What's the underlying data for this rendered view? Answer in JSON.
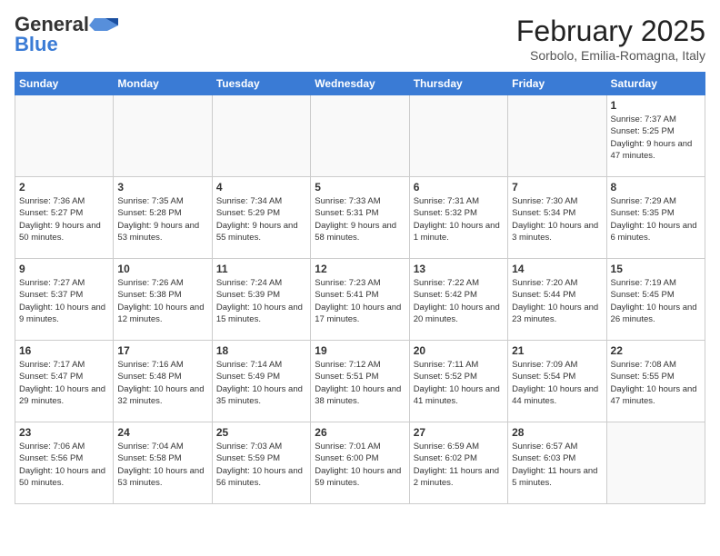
{
  "header": {
    "logo_general": "General",
    "logo_blue": "Blue",
    "month_title": "February 2025",
    "location": "Sorbolo, Emilia-Romagna, Italy"
  },
  "weekdays": [
    "Sunday",
    "Monday",
    "Tuesday",
    "Wednesday",
    "Thursday",
    "Friday",
    "Saturday"
  ],
  "weeks": [
    [
      {
        "day": "",
        "info": ""
      },
      {
        "day": "",
        "info": ""
      },
      {
        "day": "",
        "info": ""
      },
      {
        "day": "",
        "info": ""
      },
      {
        "day": "",
        "info": ""
      },
      {
        "day": "",
        "info": ""
      },
      {
        "day": "1",
        "info": "Sunrise: 7:37 AM\nSunset: 5:25 PM\nDaylight: 9 hours and 47 minutes."
      }
    ],
    [
      {
        "day": "2",
        "info": "Sunrise: 7:36 AM\nSunset: 5:27 PM\nDaylight: 9 hours and 50 minutes."
      },
      {
        "day": "3",
        "info": "Sunrise: 7:35 AM\nSunset: 5:28 PM\nDaylight: 9 hours and 53 minutes."
      },
      {
        "day": "4",
        "info": "Sunrise: 7:34 AM\nSunset: 5:29 PM\nDaylight: 9 hours and 55 minutes."
      },
      {
        "day": "5",
        "info": "Sunrise: 7:33 AM\nSunset: 5:31 PM\nDaylight: 9 hours and 58 minutes."
      },
      {
        "day": "6",
        "info": "Sunrise: 7:31 AM\nSunset: 5:32 PM\nDaylight: 10 hours and 1 minute."
      },
      {
        "day": "7",
        "info": "Sunrise: 7:30 AM\nSunset: 5:34 PM\nDaylight: 10 hours and 3 minutes."
      },
      {
        "day": "8",
        "info": "Sunrise: 7:29 AM\nSunset: 5:35 PM\nDaylight: 10 hours and 6 minutes."
      }
    ],
    [
      {
        "day": "9",
        "info": "Sunrise: 7:27 AM\nSunset: 5:37 PM\nDaylight: 10 hours and 9 minutes."
      },
      {
        "day": "10",
        "info": "Sunrise: 7:26 AM\nSunset: 5:38 PM\nDaylight: 10 hours and 12 minutes."
      },
      {
        "day": "11",
        "info": "Sunrise: 7:24 AM\nSunset: 5:39 PM\nDaylight: 10 hours and 15 minutes."
      },
      {
        "day": "12",
        "info": "Sunrise: 7:23 AM\nSunset: 5:41 PM\nDaylight: 10 hours and 17 minutes."
      },
      {
        "day": "13",
        "info": "Sunrise: 7:22 AM\nSunset: 5:42 PM\nDaylight: 10 hours and 20 minutes."
      },
      {
        "day": "14",
        "info": "Sunrise: 7:20 AM\nSunset: 5:44 PM\nDaylight: 10 hours and 23 minutes."
      },
      {
        "day": "15",
        "info": "Sunrise: 7:19 AM\nSunset: 5:45 PM\nDaylight: 10 hours and 26 minutes."
      }
    ],
    [
      {
        "day": "16",
        "info": "Sunrise: 7:17 AM\nSunset: 5:47 PM\nDaylight: 10 hours and 29 minutes."
      },
      {
        "day": "17",
        "info": "Sunrise: 7:16 AM\nSunset: 5:48 PM\nDaylight: 10 hours and 32 minutes."
      },
      {
        "day": "18",
        "info": "Sunrise: 7:14 AM\nSunset: 5:49 PM\nDaylight: 10 hours and 35 minutes."
      },
      {
        "day": "19",
        "info": "Sunrise: 7:12 AM\nSunset: 5:51 PM\nDaylight: 10 hours and 38 minutes."
      },
      {
        "day": "20",
        "info": "Sunrise: 7:11 AM\nSunset: 5:52 PM\nDaylight: 10 hours and 41 minutes."
      },
      {
        "day": "21",
        "info": "Sunrise: 7:09 AM\nSunset: 5:54 PM\nDaylight: 10 hours and 44 minutes."
      },
      {
        "day": "22",
        "info": "Sunrise: 7:08 AM\nSunset: 5:55 PM\nDaylight: 10 hours and 47 minutes."
      }
    ],
    [
      {
        "day": "23",
        "info": "Sunrise: 7:06 AM\nSunset: 5:56 PM\nDaylight: 10 hours and 50 minutes."
      },
      {
        "day": "24",
        "info": "Sunrise: 7:04 AM\nSunset: 5:58 PM\nDaylight: 10 hours and 53 minutes."
      },
      {
        "day": "25",
        "info": "Sunrise: 7:03 AM\nSunset: 5:59 PM\nDaylight: 10 hours and 56 minutes."
      },
      {
        "day": "26",
        "info": "Sunrise: 7:01 AM\nSunset: 6:00 PM\nDaylight: 10 hours and 59 minutes."
      },
      {
        "day": "27",
        "info": "Sunrise: 6:59 AM\nSunset: 6:02 PM\nDaylight: 11 hours and 2 minutes."
      },
      {
        "day": "28",
        "info": "Sunrise: 6:57 AM\nSunset: 6:03 PM\nDaylight: 11 hours and 5 minutes."
      },
      {
        "day": "",
        "info": ""
      }
    ]
  ]
}
